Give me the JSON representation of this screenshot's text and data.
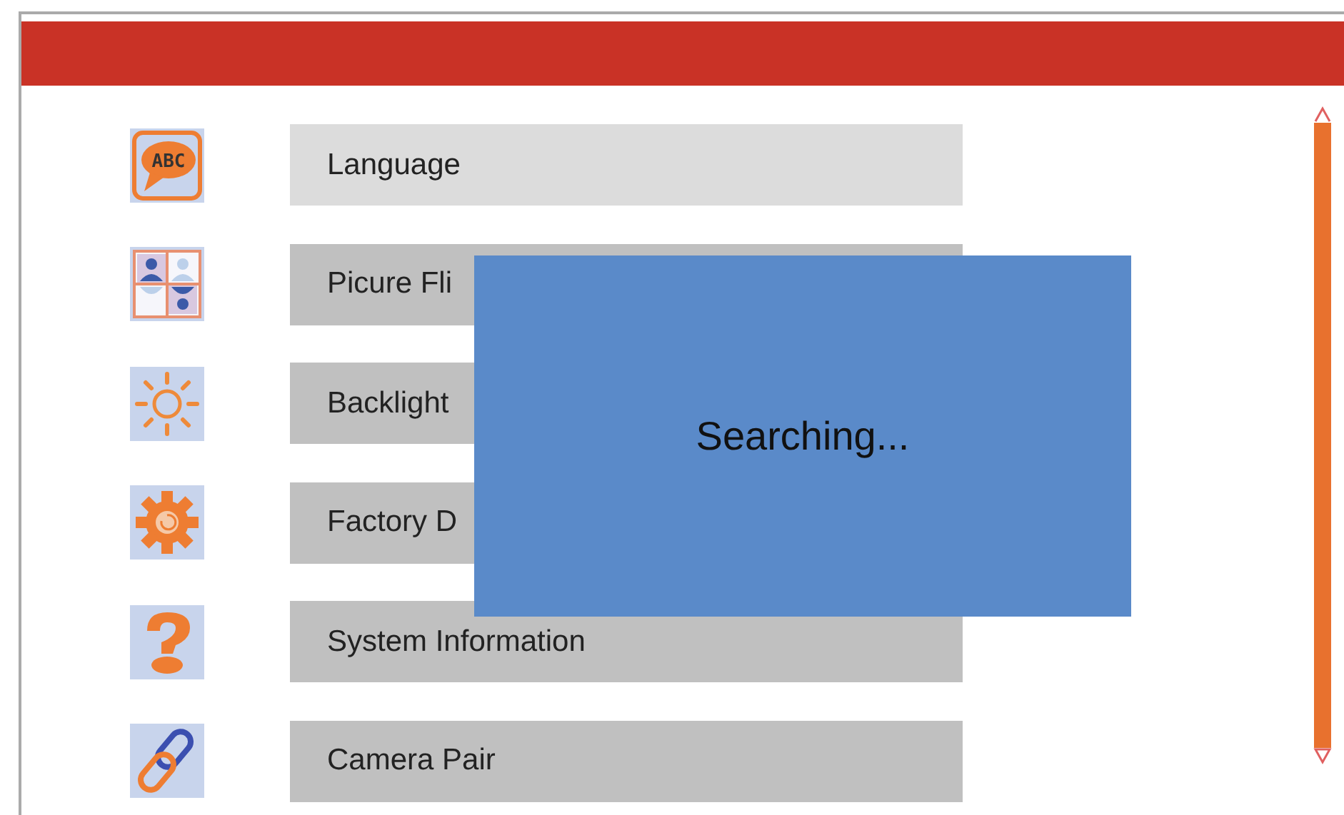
{
  "menu": [
    {
      "kind": "language",
      "label": "Language",
      "icon_text": "ABC",
      "selected": true
    },
    {
      "kind": "flip",
      "label": "Picure Fli",
      "selected": false
    },
    {
      "kind": "backlight",
      "label": "Backlight",
      "selected": false
    },
    {
      "kind": "factory",
      "label": "Factory D",
      "selected": false
    },
    {
      "kind": "info",
      "label": "System Information",
      "selected": false
    },
    {
      "kind": "pair",
      "label": "Camera Pair",
      "selected": false
    }
  ],
  "dialog": {
    "message": "Searching..."
  }
}
